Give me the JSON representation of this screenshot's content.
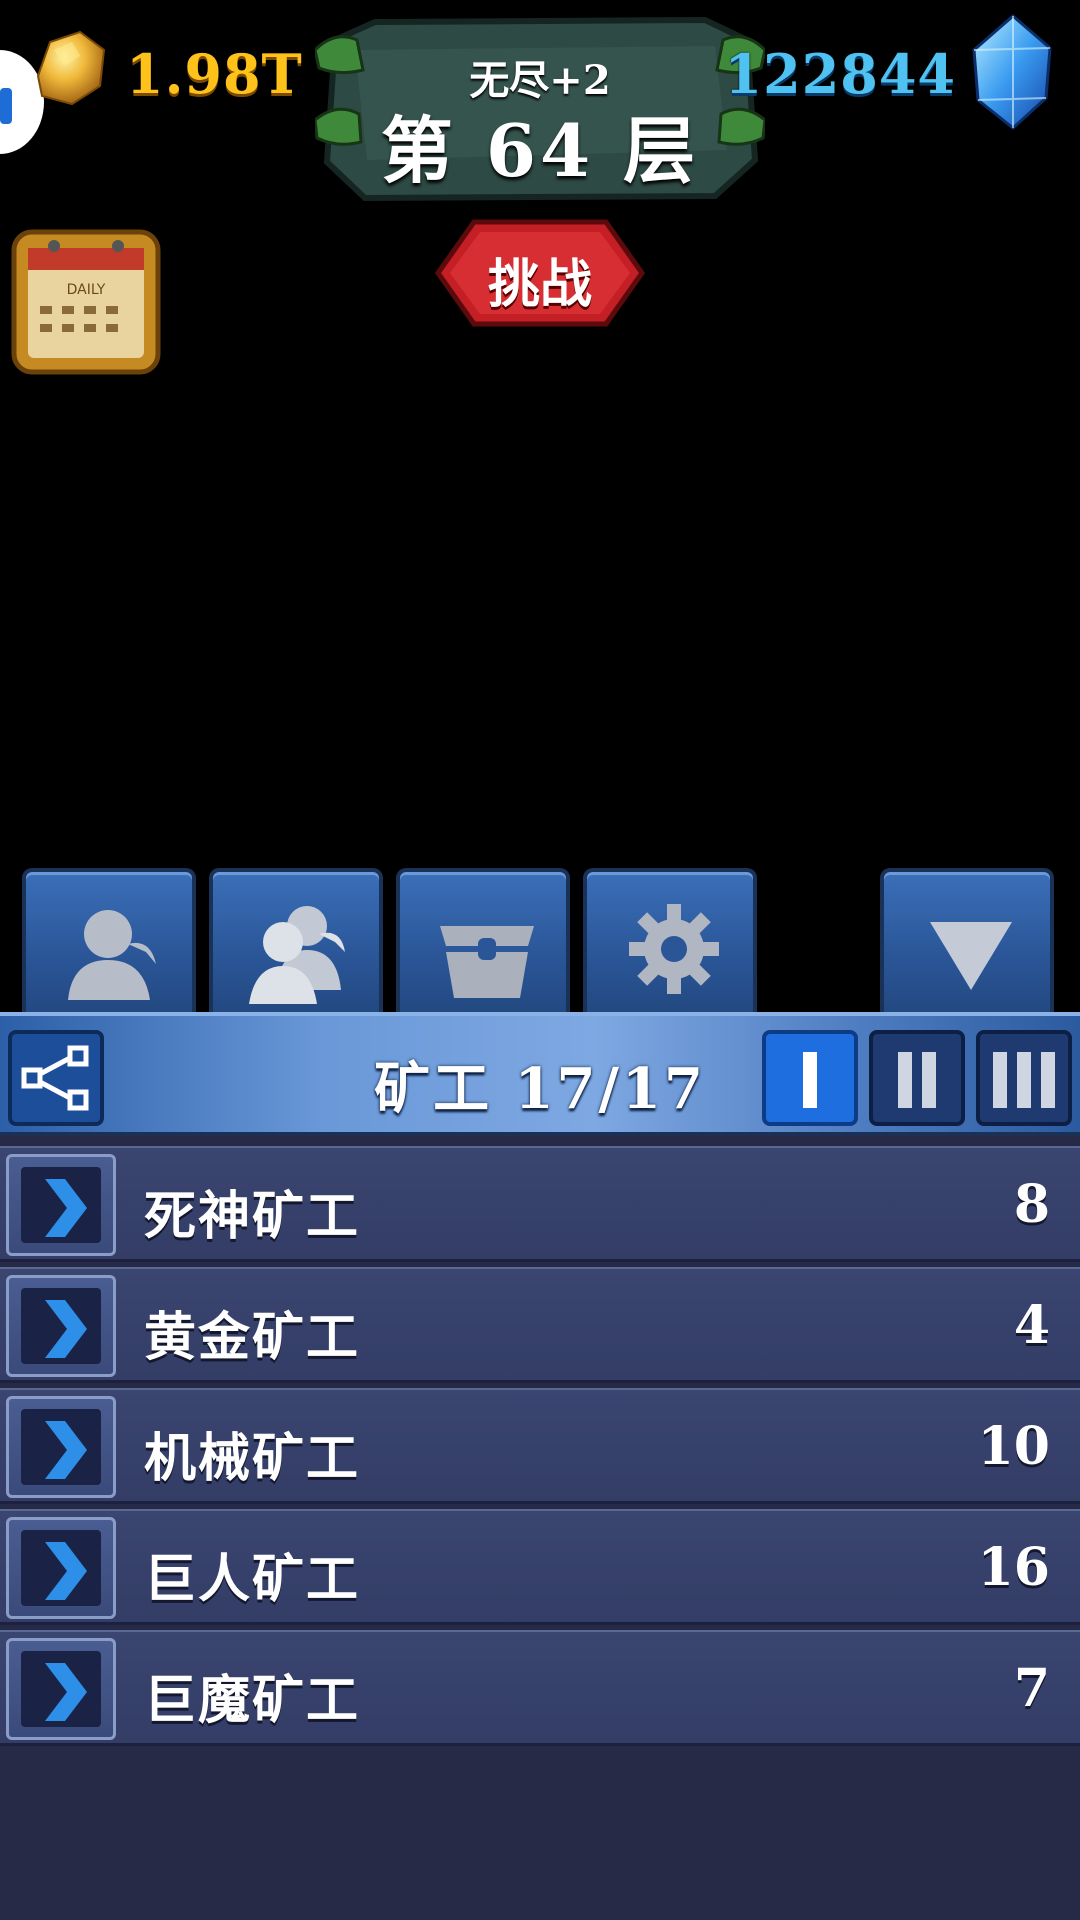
{
  "hud": {
    "gold_amount": "1.98T",
    "gem_amount": "122844"
  },
  "floor": {
    "mode": "无尽+2",
    "title": "第 64 层"
  },
  "challenge": {
    "label": "挑战"
  },
  "daily": {
    "label": "DAILY"
  },
  "tabs": [
    {
      "icon": "miner-icon"
    },
    {
      "icon": "miners-group-icon"
    },
    {
      "icon": "chest-icon"
    },
    {
      "icon": "gear-icon"
    },
    {
      "icon": "collapse-arrow-icon"
    }
  ],
  "panel": {
    "title": "矿工 17/17",
    "levels": [
      "I",
      "II",
      "III"
    ],
    "active_level": "I"
  },
  "miners": [
    {
      "name": "死神矿工",
      "count": "8"
    },
    {
      "name": "黄金矿工",
      "count": "4"
    },
    {
      "name": "机械矿工",
      "count": "10"
    },
    {
      "name": "巨人矿工",
      "count": "16"
    },
    {
      "name": "巨魔矿工",
      "count": "7"
    }
  ],
  "colors": {
    "gold": "#ffc21a",
    "gem": "#4fc2f2",
    "panel_bg": "#262a47",
    "row_bg": "#3a4570",
    "tab_blue": "#2a5597",
    "challenge_red": "#c41f24"
  }
}
